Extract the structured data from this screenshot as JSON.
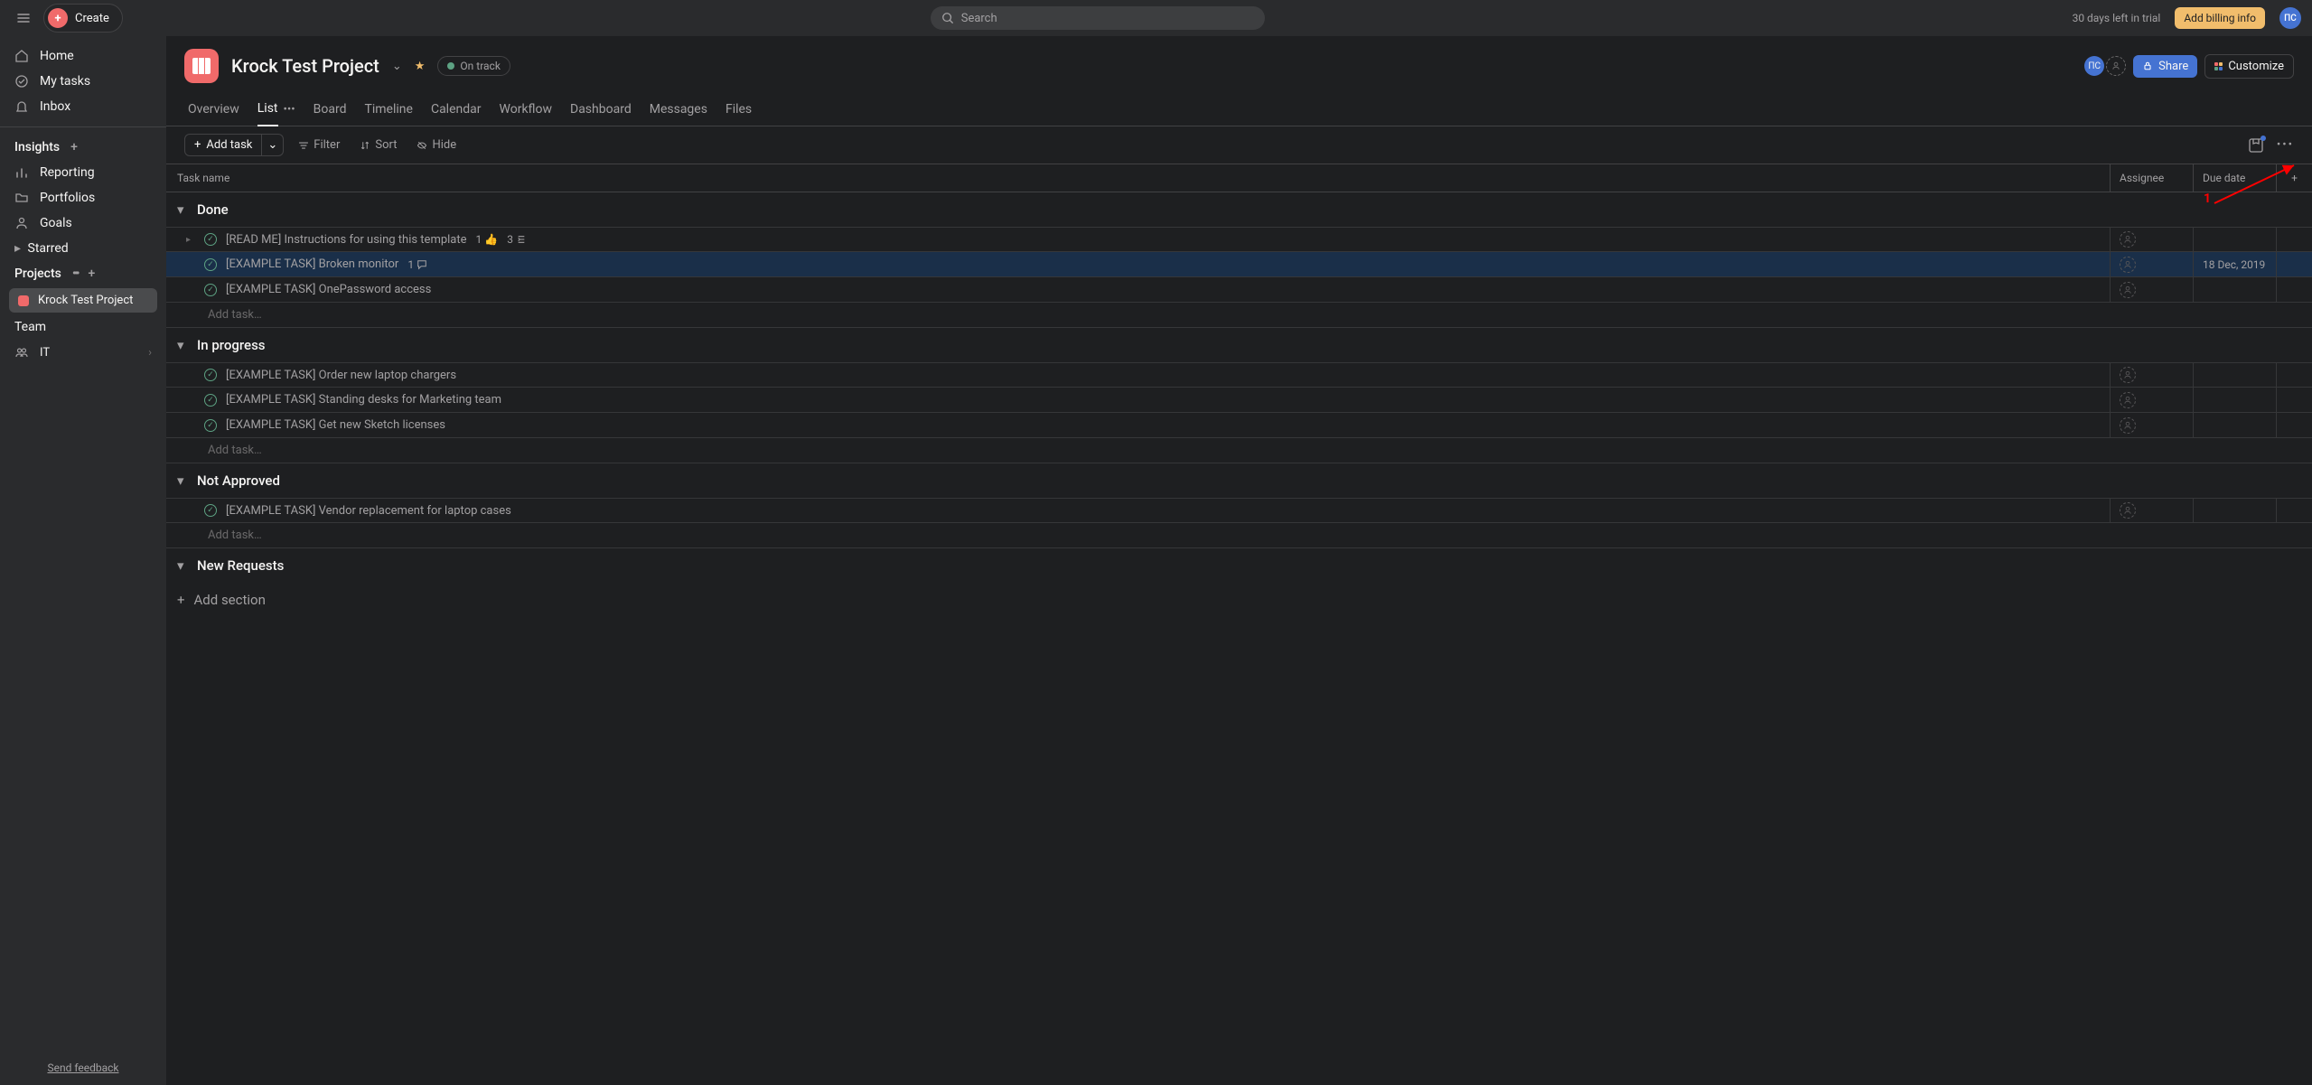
{
  "topbar": {
    "create_label": "Create",
    "search_placeholder": "Search",
    "trial_text": "30 days left in trial",
    "billing_label": "Add billing info",
    "avatar_initials": "ПС"
  },
  "sidebar": {
    "home": "Home",
    "my_tasks": "My tasks",
    "inbox": "Inbox",
    "insights_header": "Insights",
    "reporting": "Reporting",
    "portfolios": "Portfolios",
    "goals": "Goals",
    "starred_header": "Starred",
    "projects_header": "Projects",
    "project_name": "Krock Test Project",
    "team_header": "Team",
    "team_it": "IT",
    "feedback": "Send feedback"
  },
  "project": {
    "title": "Krock Test Project",
    "status": "On track",
    "share_label": "Share",
    "customize_label": "Customize",
    "avatar_initials": "ПС"
  },
  "tabs": {
    "overview": "Overview",
    "list": "List",
    "board": "Board",
    "timeline": "Timeline",
    "calendar": "Calendar",
    "workflow": "Workflow",
    "dashboard": "Dashboard",
    "messages": "Messages",
    "files": "Files"
  },
  "toolbar": {
    "add_task": "Add task",
    "filter": "Filter",
    "sort": "Sort",
    "hide": "Hide"
  },
  "columns": {
    "task_name": "Task name",
    "assignee": "Assignee",
    "due_date": "Due date"
  },
  "sections": [
    {
      "name": "Done",
      "tasks": [
        {
          "title": "[READ ME] Instructions for using this template",
          "likes": "1",
          "subtasks": "3",
          "expandable": true,
          "due": ""
        },
        {
          "title": "[EXAMPLE TASK] Broken monitor",
          "comments": "1",
          "due": "18 Dec, 2019",
          "highlight": true
        },
        {
          "title": "[EXAMPLE TASK] OnePassword access",
          "due": ""
        }
      ],
      "add_label": "Add task…"
    },
    {
      "name": "In progress",
      "tasks": [
        {
          "title": "[EXAMPLE TASK] Order new laptop chargers",
          "due": ""
        },
        {
          "title": "[EXAMPLE TASK] Standing desks for Marketing team",
          "due": ""
        },
        {
          "title": "[EXAMPLE TASK] Get new Sketch licenses",
          "due": ""
        }
      ],
      "add_label": "Add task…"
    },
    {
      "name": "Not Approved",
      "tasks": [
        {
          "title": "[EXAMPLE TASK] Vendor replacement for laptop cases",
          "due": ""
        }
      ],
      "add_label": "Add task…"
    },
    {
      "name": "New Requests",
      "tasks": [],
      "add_label": ""
    }
  ],
  "add_section_label": "Add section",
  "annotation": {
    "label": "1"
  }
}
